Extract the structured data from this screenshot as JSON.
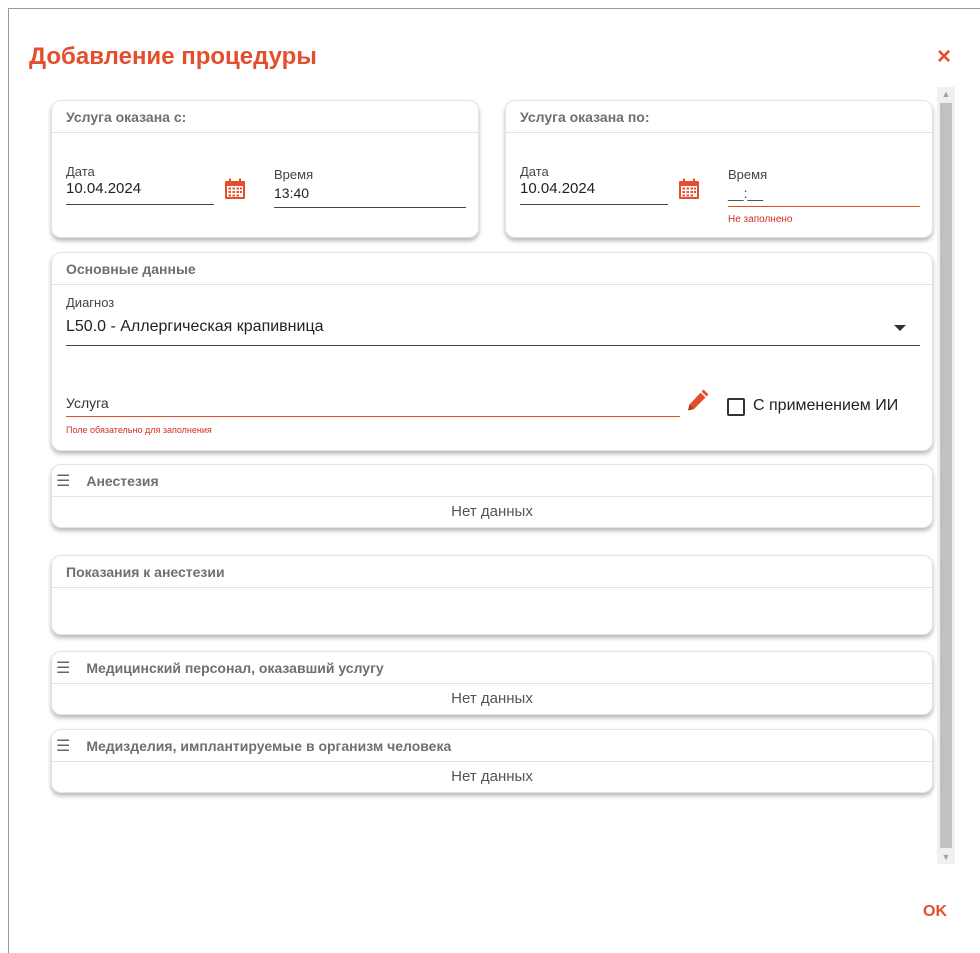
{
  "dialog": {
    "title": "Добавление процедуры",
    "close_label": "×",
    "ok_label": "OK"
  },
  "from": {
    "header": "Услуга оказана с:",
    "date_label": "Дата",
    "date_value": "10.04.2024",
    "time_label": "Время",
    "time_value": "13:40"
  },
  "to": {
    "header": "Услуга оказана по:",
    "date_label": "Дата",
    "date_value": "10.04.2024",
    "time_label": "Время",
    "time_value": "__:__",
    "time_error": "Не заполнено"
  },
  "main": {
    "header": "Основные данные",
    "diagnosis_label": "Диагноз",
    "diagnosis_value": "L50.0 - Аллергическая крапивница",
    "service_label": "Услуга",
    "service_error": "Поле обязательно для заполнения",
    "ai_checkbox_label": "С применением ИИ",
    "ai_checked": false
  },
  "anesthesia": {
    "header": "Анестезия",
    "empty": "Нет данных"
  },
  "indications": {
    "header": "Показания к анестезии"
  },
  "staff": {
    "header": "Медицинский персонал, оказавший услугу",
    "empty": "Нет данных"
  },
  "devices": {
    "header": "Медизделия, имплантируемые в организм человека",
    "empty": "Нет данных"
  },
  "colors": {
    "accent": "#e54e2c",
    "error": "#d62d20",
    "header_text": "#6f6f6f"
  }
}
